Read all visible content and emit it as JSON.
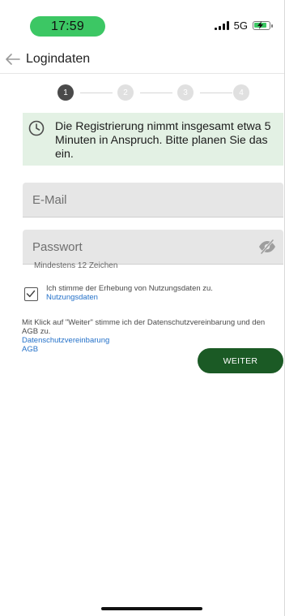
{
  "status_bar": {
    "time": "17:59",
    "network": "5G",
    "time_pill_color": "#3cc764",
    "battery_charging": true
  },
  "header": {
    "back_icon": "arrow-left-icon",
    "title": "Logindaten"
  },
  "stepper": {
    "current_step": 1,
    "steps": [
      "1",
      "2",
      "3",
      "4"
    ],
    "active_color": "#4a4a4a",
    "inactive_color": "#e0e0e0"
  },
  "info": {
    "icon": "clock-icon",
    "text": "Die Registrierung nimmt insgesamt etwa 5 Minuten in Anspruch. Bitte planen Sie das ein.",
    "background": "#e3f1e4"
  },
  "form": {
    "email": {
      "placeholder": "E-Mail",
      "value": ""
    },
    "password": {
      "placeholder": "Passwort",
      "value": "",
      "icon": "eye-off-icon",
      "helper": "Mindestens 12 Zeichen"
    }
  },
  "consent": {
    "checked": true,
    "text": "Ich stimme der Erhebung von Nutzungsdaten zu.",
    "link": "Nutzungsdaten"
  },
  "legal": {
    "text": "Mit Klick auf \"Weiter\" stimme ich der Datenschutzvereinbarung und den AGB zu.",
    "privacy_link": "Datenschutzvereinbarung",
    "terms_link": "AGB"
  },
  "actions": {
    "next_label": "WEITER",
    "button_color": "#1b5a25",
    "link_color": "#2471c9"
  }
}
